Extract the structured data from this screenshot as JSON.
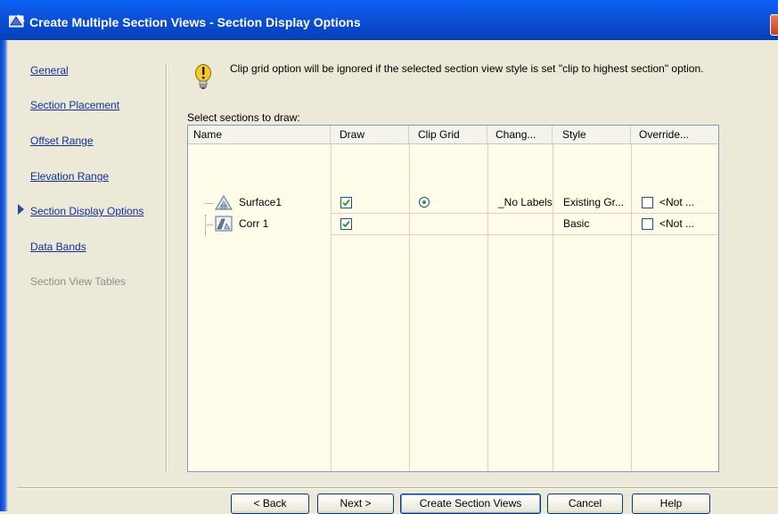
{
  "window": {
    "title": "Create Multiple Section Views - Section Display Options"
  },
  "nav": {
    "items": [
      {
        "label": "General",
        "state": "link"
      },
      {
        "label": "Section Placement",
        "state": "link"
      },
      {
        "label": "Offset Range",
        "state": "link"
      },
      {
        "label": "Elevation Range",
        "state": "link"
      },
      {
        "label": "Section Display Options",
        "state": "current"
      },
      {
        "label": "Data Bands",
        "state": "link"
      },
      {
        "label": "Section View Tables",
        "state": "disabled"
      }
    ]
  },
  "info": {
    "icon": "warning-bulb-icon",
    "text": "Clip grid option will be ignored if the selected section view style is set \"clip to highest section\" option."
  },
  "grid": {
    "label": "Select sections to draw:",
    "columns": [
      "Name",
      "Draw",
      "Clip Grid",
      "Chang...",
      "Style",
      "Override..."
    ],
    "rows": [
      {
        "name": "Surface1",
        "icon": "surface-icon",
        "draw": true,
        "clip_grid": true,
        "change": "_No Labels",
        "style": "Existing Gr...",
        "override_checked": false,
        "override_text": "<Not ..."
      },
      {
        "name": "Corr 1",
        "icon": "corridor-icon",
        "draw": true,
        "clip_grid": false,
        "change": "",
        "style": "Basic",
        "override_checked": false,
        "override_text": "<Not ..."
      }
    ]
  },
  "buttons": {
    "back": "< Back",
    "next": "Next >",
    "create": "Create Section Views",
    "cancel": "Cancel",
    "help": "Help"
  },
  "colors": {
    "titlebar": "#0a5ce8",
    "link": "#0f2f9c",
    "grid_background": "#fffdea",
    "check_mark": "#21a121"
  }
}
